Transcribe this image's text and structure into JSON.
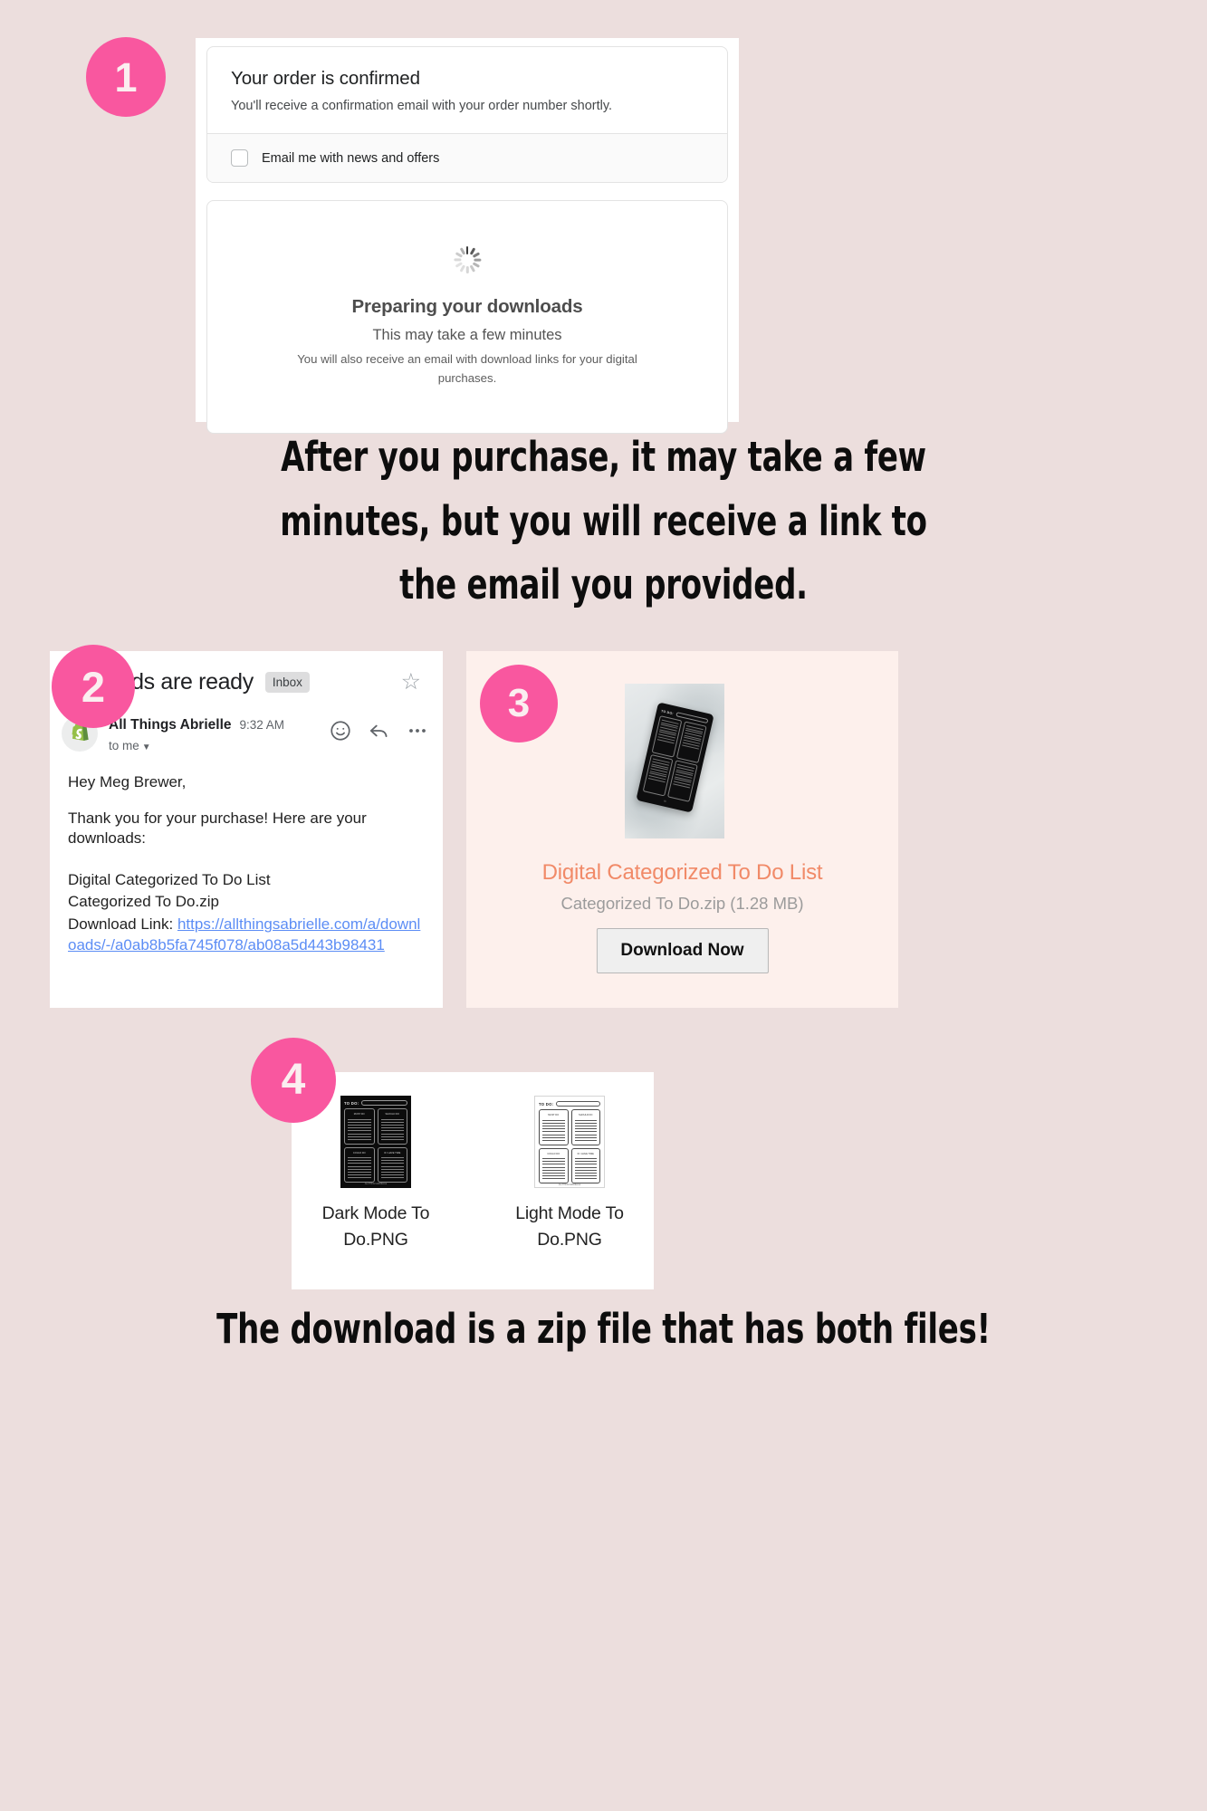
{
  "theme": {
    "page_background": "#ecdedd",
    "badge_color": "#f9579f",
    "download_card_background": "#fdf0ec",
    "product_title_color": "#f18a68",
    "link_color": "#5c8df5"
  },
  "badges": {
    "one": "1",
    "two": "2",
    "three": "3",
    "four": "4"
  },
  "step1": {
    "order_title": "Your order is confirmed",
    "order_subtitle": "You'll receive a confirmation email with your order number shortly.",
    "checkbox_label": "Email me with news and offers",
    "spinner_icon": "loading-spinner-icon",
    "downloads_heading": "Preparing your downloads",
    "downloads_sub1": "This may take a few minutes",
    "downloads_sub2": "You will also receive an email with download links for your digital purchases."
  },
  "headline_top": [
    "After you purchase, it may take a few",
    "minutes, but you will receive a link to",
    "the email you provided."
  ],
  "headline_bottom": "The download is a zip file that has both files!",
  "step2_email": {
    "subject": "ownloads are ready",
    "label_chip": "Inbox",
    "star_icon": "star-outline-icon",
    "avatar_icon": "shopify-bag-icon",
    "sender": "All Things Abrielle",
    "time": "9:32 AM",
    "recipient": "to me",
    "recipient_caret": "chevron-down-icon",
    "emoji_icon": "add-reaction-icon",
    "reply_icon": "reply-arrow-icon",
    "more_icon": "more-options-icon",
    "greeting": "Hey Meg Brewer,",
    "body": "Thank you for your purchase! Here are your downloads:",
    "product_name": "Digital Categorized To Do List",
    "file_name": "Categorized To Do.zip",
    "download_link_prefix": "Download Link: ",
    "download_link": "https://allthingsabrielle.com/a/downloads/-/a0ab8b5fa745f078/ab08a5d443b98431"
  },
  "step3_download": {
    "product_image_alt": "tablet-todo-list-photo",
    "title": "Digital Categorized To Do List",
    "file_meta": "Categorized To Do.zip (1.28 MB)",
    "button_label": "Download Now"
  },
  "step4_files": {
    "items": [
      {
        "thumb": "dark-mode-todo-thumbnail",
        "label": "Dark Mode To Do.PNG",
        "mode": "dark"
      },
      {
        "thumb": "light-mode-todo-thumbnail",
        "label": "Light Mode To Do.PNG",
        "mode": "light"
      }
    ],
    "thumb_header": "TO DO:",
    "quadrant_titles": [
      "MUST DO",
      "SHOULD DO",
      "COULD DO",
      "IF I HAVE TIME"
    ],
    "thumb_footer": "ALLTHINGSABRIELLE"
  }
}
